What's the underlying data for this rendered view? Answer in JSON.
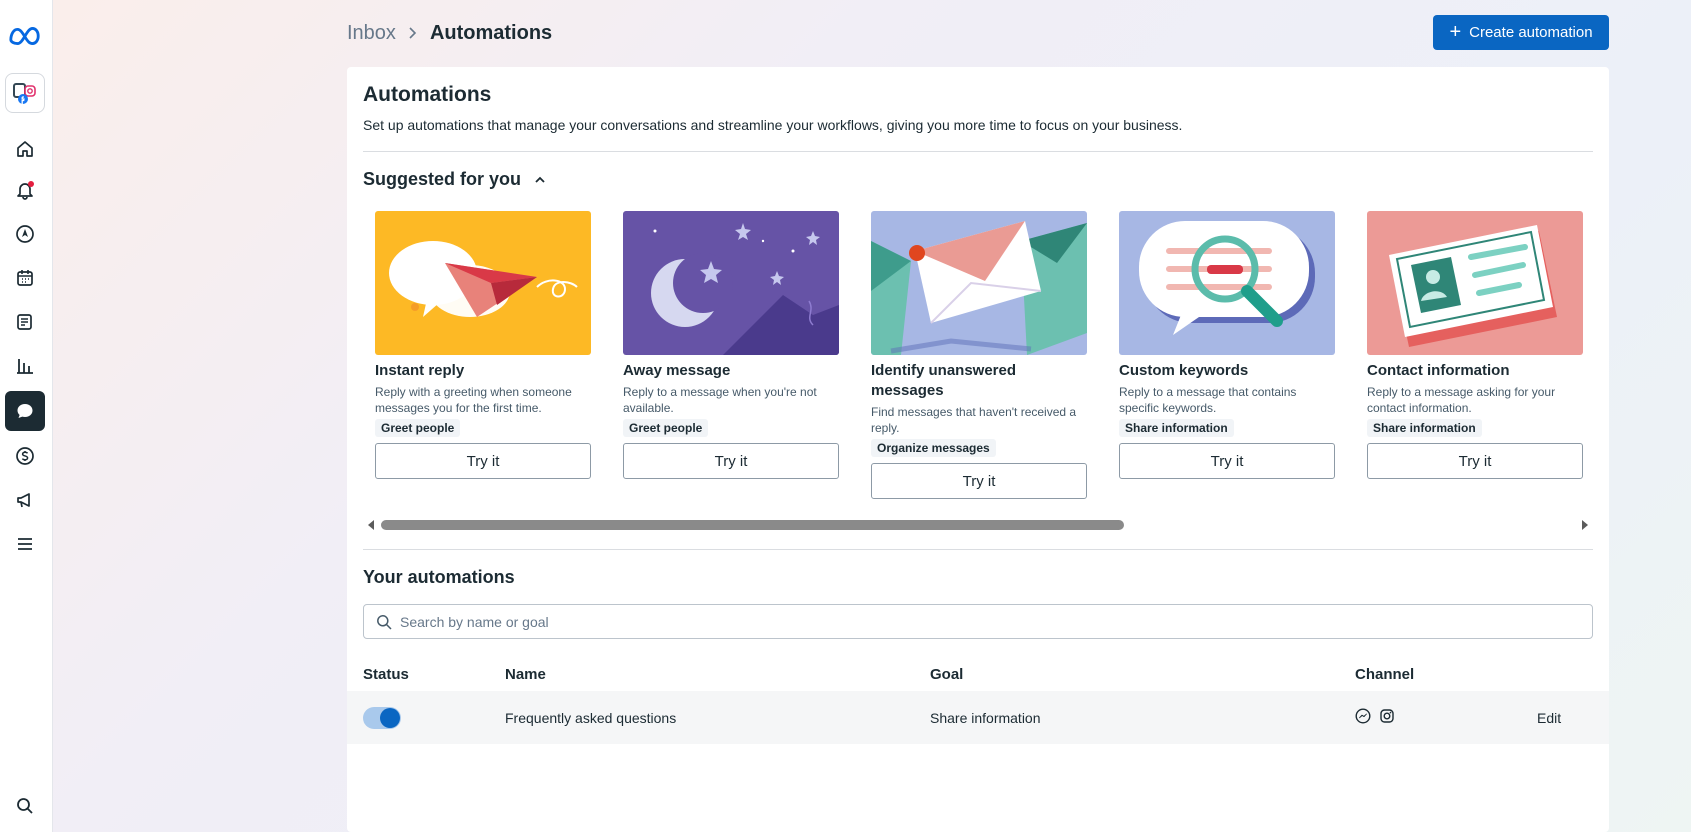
{
  "breadcrumb": {
    "parent": "Inbox",
    "current": "Automations"
  },
  "header": {
    "create_label": "Create automation"
  },
  "panel": {
    "title": "Automations",
    "description": "Set up automations that manage your conversations and streamline your workflows, giving you more time to focus on your business."
  },
  "suggested": {
    "title": "Suggested for you",
    "cards": [
      {
        "title": "Instant reply",
        "desc": "Reply with a greeting when someone messages you for the first time.",
        "tag": "Greet people",
        "button": "Try it",
        "image": "paper-plane-illustration",
        "bg": "#fdb925"
      },
      {
        "title": "Away message",
        "desc": "Reply to a message when you're not available.",
        "tag": "Greet people",
        "button": "Try it",
        "image": "moon-illustration",
        "bg": "#6653a6"
      },
      {
        "title": "Identify unanswered messages",
        "desc": "Find messages that haven't received a reply.",
        "tag": "Organize messages",
        "button": "Try it",
        "image": "envelopes-illustration",
        "bg": "#a7b7e4"
      },
      {
        "title": "Custom keywords",
        "desc": "Reply to a message that contains specific keywords.",
        "tag": "Share information",
        "button": "Try it",
        "image": "magnifier-illustration",
        "bg": "#a7b7e4"
      },
      {
        "title": "Contact information",
        "desc": "Reply to a message asking for your contact information.",
        "tag": "Share information",
        "button": "Try it",
        "image": "contact-card-illustration",
        "bg": "#ec9a96"
      }
    ]
  },
  "yours": {
    "title": "Your automations",
    "search_placeholder": "Search by name or goal",
    "columns": {
      "status": "Status",
      "name": "Name",
      "goal": "Goal",
      "channel": "Channel"
    },
    "rows": [
      {
        "status_on": true,
        "name": "Frequently asked questions",
        "goal": "Share information",
        "channels": [
          "messenger-icon",
          "instagram-icon"
        ],
        "action": "Edit"
      }
    ]
  },
  "rail": {
    "items": [
      "meta-logo",
      "account-icon",
      "home-icon",
      "notifications-icon",
      "compass-icon",
      "calendar-icon",
      "posts-icon",
      "insights-icon",
      "inbox-icon",
      "monetization-icon",
      "ads-icon",
      "menu-icon",
      "search-icon"
    ],
    "active": "inbox-icon"
  },
  "colors": {
    "accent": "#0a66c2",
    "text": "#1c2b33",
    "rail_active": "#1c2b33"
  }
}
